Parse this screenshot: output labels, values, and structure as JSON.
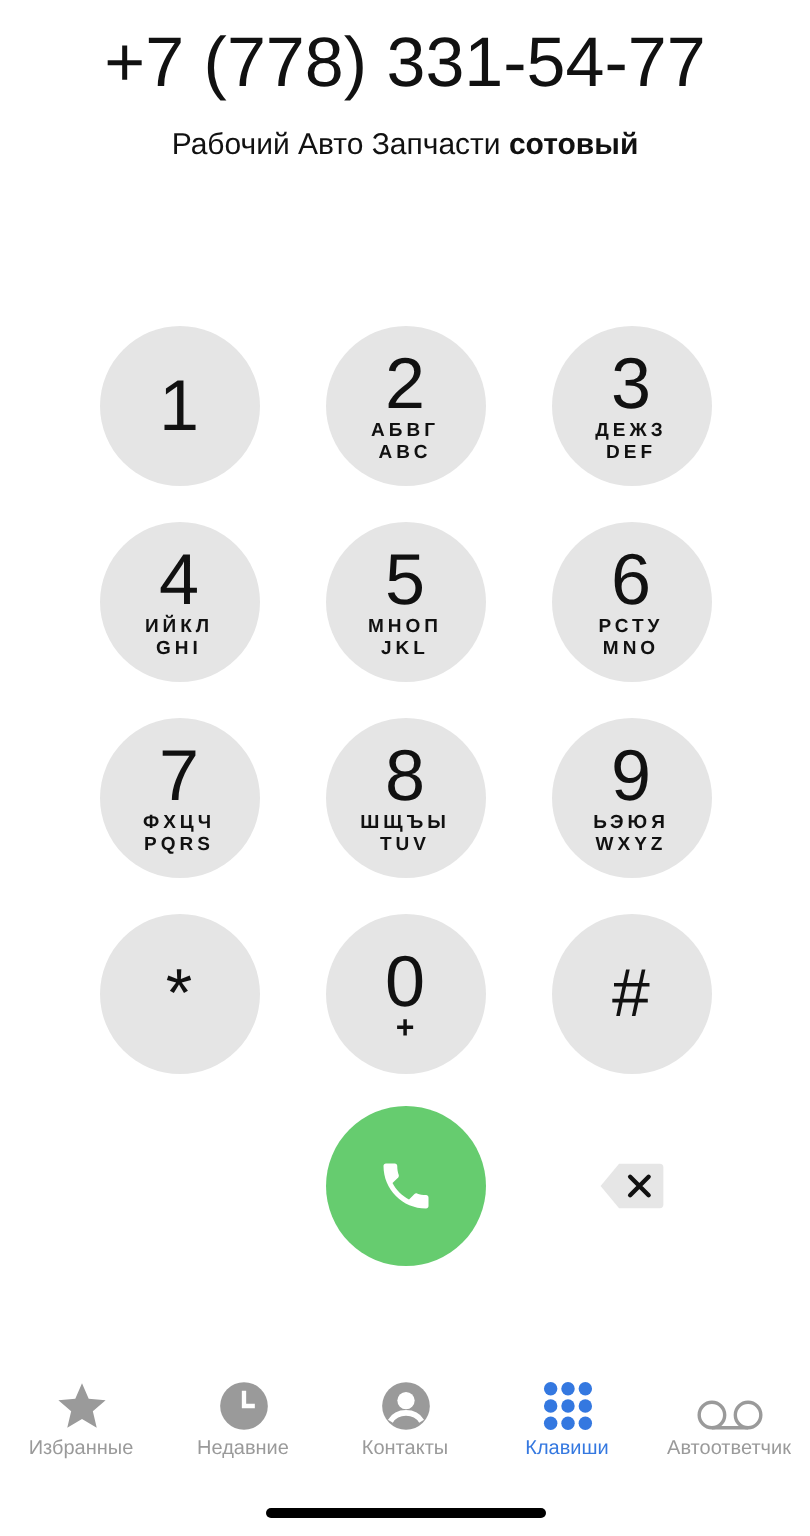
{
  "number": "+7 (778) 331-54-77",
  "contact_label": "Рабочий  Авто Запчасти **сотовый**",
  "keys": [
    {
      "kind": "digit",
      "symbol": "1"
    },
    {
      "kind": "digit",
      "symbol": "2",
      "letters": [
        "АБВГ",
        "ABC"
      ]
    },
    {
      "kind": "digit",
      "symbol": "3",
      "letters": [
        "ДЕЖЗ",
        "DEF"
      ]
    },
    {
      "kind": "digit",
      "symbol": "4",
      "letters": [
        "ИЙКЛ",
        "GHI"
      ]
    },
    {
      "kind": "digit",
      "symbol": "5",
      "letters": [
        "МНОП",
        "JKL"
      ]
    },
    {
      "kind": "digit",
      "symbol": "6",
      "letters": [
        "РСТУ",
        "MNO"
      ]
    },
    {
      "kind": "digit",
      "symbol": "7",
      "letters": [
        "ФХЦЧ",
        "PQRS"
      ]
    },
    {
      "kind": "digit",
      "symbol": "8",
      "letters": [
        "ШЩЪЫ",
        "TUV"
      ]
    },
    {
      "kind": "digit",
      "symbol": "9",
      "letters": [
        "ЬЭЮЯ",
        "WXYZ"
      ]
    },
    {
      "kind": "symbol",
      "symbol": "*"
    },
    {
      "kind": "digit",
      "symbol": "0",
      "letters": [
        "+"
      ]
    },
    {
      "kind": "symbol",
      "symbol": "#"
    }
  ],
  "tabs": [
    {
      "kind": "star",
      "label": "Избранные",
      "selected": false
    },
    {
      "kind": "clock",
      "label": "Недавние",
      "selected": false
    },
    {
      "kind": "person",
      "label": "Контакты",
      "selected": false
    },
    {
      "kind": "keypad",
      "label": "Клавиши",
      "selected": true
    },
    {
      "kind": "voicemail",
      "label": "Автоответчик",
      "selected": false
    }
  ]
}
